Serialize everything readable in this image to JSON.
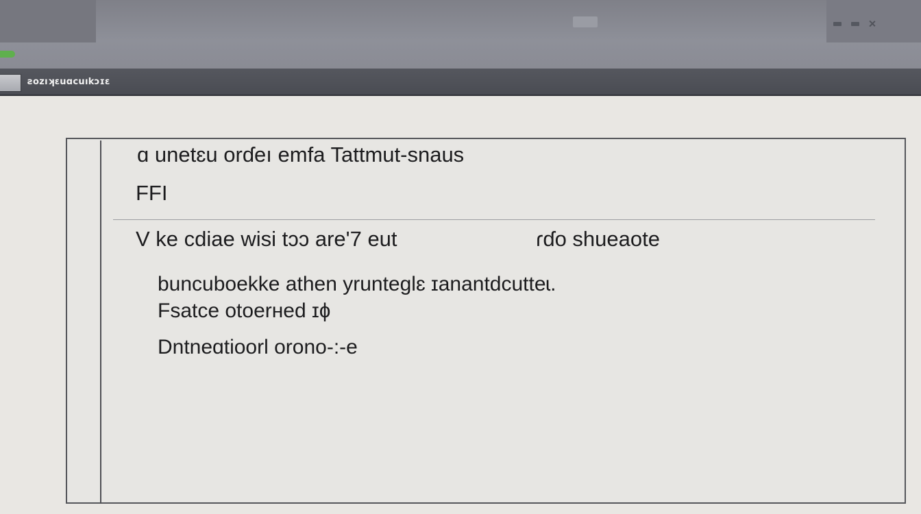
{
  "titlebar": {
    "controls": [
      "minimize-icon",
      "restore-icon",
      "close-icon"
    ]
  },
  "toolbar": {
    "label": "ƨozıʞɛuɑcuıkɔɪɛ"
  },
  "panel": {
    "heading": "ɑ unetɛu orɗeı emfa Tattmut-snaus",
    "subheading": "FFI",
    "line_a": "V ke cdiae wisi  tɔɔ are'7 eut",
    "line_b": "ɾɗo shueaote",
    "paragraph_1": "buncuboekke athen yrunteglɛ ɪanantdcutteɩ.",
    "paragraph_2": "Fsatce otoerнed ɪɸ",
    "paragraph_3": "Dntneɑtioorl orono-:-e"
  },
  "colors": {
    "titlebar": "#8e9099",
    "toolbar": "#4f5158",
    "status_indicator": "#5fb04d",
    "panel_border": "#55565b",
    "background": "#e9e7e3"
  }
}
